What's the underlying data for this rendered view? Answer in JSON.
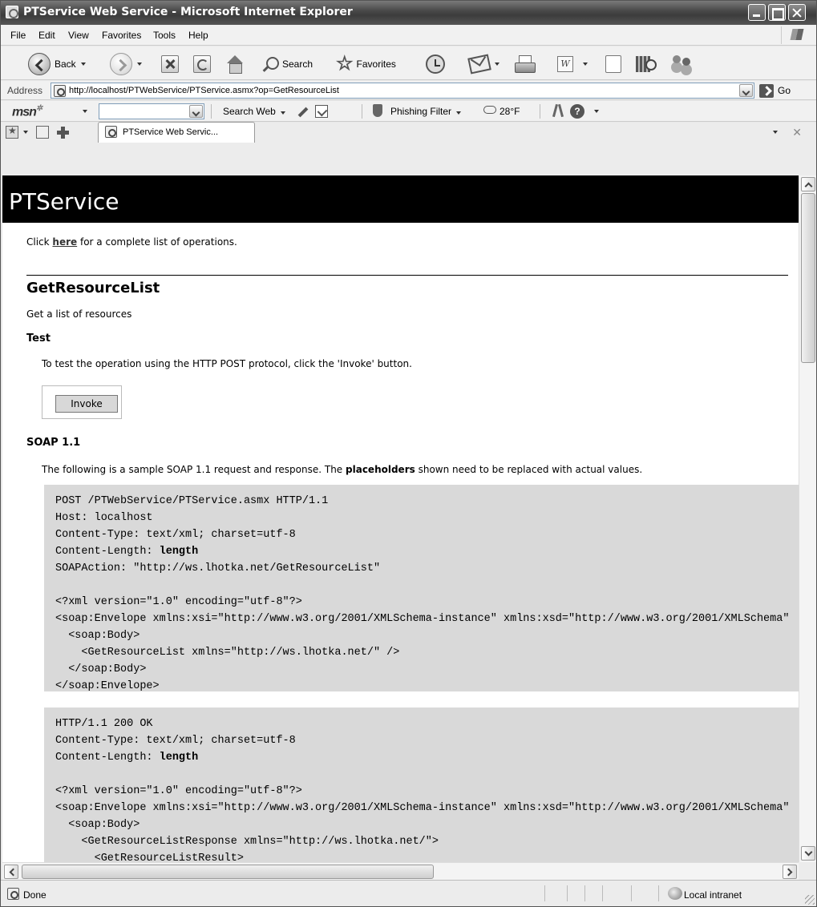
{
  "window": {
    "title": "PTService Web Service - Microsoft Internet Explorer"
  },
  "menu": [
    "File",
    "Edit",
    "View",
    "Favorites",
    "Tools",
    "Help"
  ],
  "toolbar": {
    "back_label": "Back",
    "search_label": "Search",
    "favorites_label": "Favorites"
  },
  "address": {
    "label": "Address",
    "url": "http://localhost/PTWebService/PTService.asmx?op=GetResourceList",
    "go_label": "Go"
  },
  "msn": {
    "logo": "msn",
    "search_web": "Search Web",
    "phishing_filter": "Phishing Filter",
    "weather": "28°F"
  },
  "tabs": [
    {
      "label": "PTService Web Servic..."
    }
  ],
  "page": {
    "service_name": "PTService",
    "intro_prefix": "Click ",
    "intro_link": "here",
    "intro_suffix": " for a complete list of operations.",
    "operation": "GetResourceList",
    "operation_desc": "Get a list of resources",
    "test_heading": "Test",
    "test_text": "To test the operation using the HTTP POST protocol, click the 'Invoke' button.",
    "invoke_label": "Invoke",
    "soap_heading": "SOAP 1.1",
    "soap_text_prefix": "The following is a sample SOAP 1.1 request and response. The ",
    "soap_text_bold": "placeholders",
    "soap_text_suffix": " shown need to be replaced with actual values.",
    "request_lines": [
      "POST /PTWebService/PTService.asmx HTTP/1.1",
      "Host: localhost",
      "Content-Type: text/xml; charset=utf-8",
      "Content-Length: ",
      "SOAPAction: \"http://ws.lhotka.net/GetResourceList\"",
      "",
      "<?xml version=\"1.0\" encoding=\"utf-8\"?>",
      "<soap:Envelope xmlns:xsi=\"http://www.w3.org/2001/XMLSchema-instance\" xmlns:xsd=\"http://www.w3.org/2001/XMLSchema\"",
      "  <soap:Body>",
      "    <GetResourceList xmlns=\"http://ws.lhotka.net/\" />",
      "  </soap:Body>",
      "</soap:Envelope>"
    ],
    "response_lines": [
      "HTTP/1.1 200 OK",
      "Content-Type: text/xml; charset=utf-8",
      "Content-Length: ",
      "",
      "<?xml version=\"1.0\" encoding=\"utf-8\"?>",
      "<soap:Envelope xmlns:xsi=\"http://www.w3.org/2001/XMLSchema-instance\" xmlns:xsd=\"http://www.w3.org/2001/XMLSchema\"",
      "  <soap:Body>",
      "    <GetResourceListResponse xmlns=\"http://ws.lhotka.net/\">",
      "      <GetResourceListResult>"
    ],
    "length_placeholder": "length"
  },
  "status": {
    "text": "Done",
    "zone": "Local intranet"
  }
}
